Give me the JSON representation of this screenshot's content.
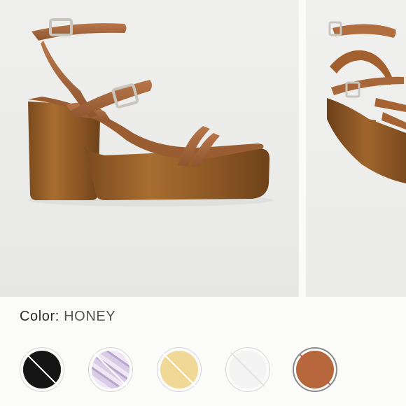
{
  "product_gallery": {
    "images": [
      {
        "name": "sandal-side-view",
        "active": true
      },
      {
        "name": "sandal-front-view",
        "active": false
      }
    ]
  },
  "color_selector": {
    "label": "Color:",
    "selected_value": "HONEY",
    "swatches": [
      {
        "name": "black",
        "color": "#141414",
        "available": false,
        "selected": false
      },
      {
        "name": "lavender-pattern",
        "color": "#c9b9d8",
        "available": false,
        "selected": false
      },
      {
        "name": "yellow",
        "color": "#f0d897",
        "available": false,
        "selected": false
      },
      {
        "name": "white",
        "color": "#f4f4f4",
        "available": false,
        "selected": false
      },
      {
        "name": "honey",
        "color": "#b7673c",
        "available": false,
        "selected": true
      }
    ]
  }
}
